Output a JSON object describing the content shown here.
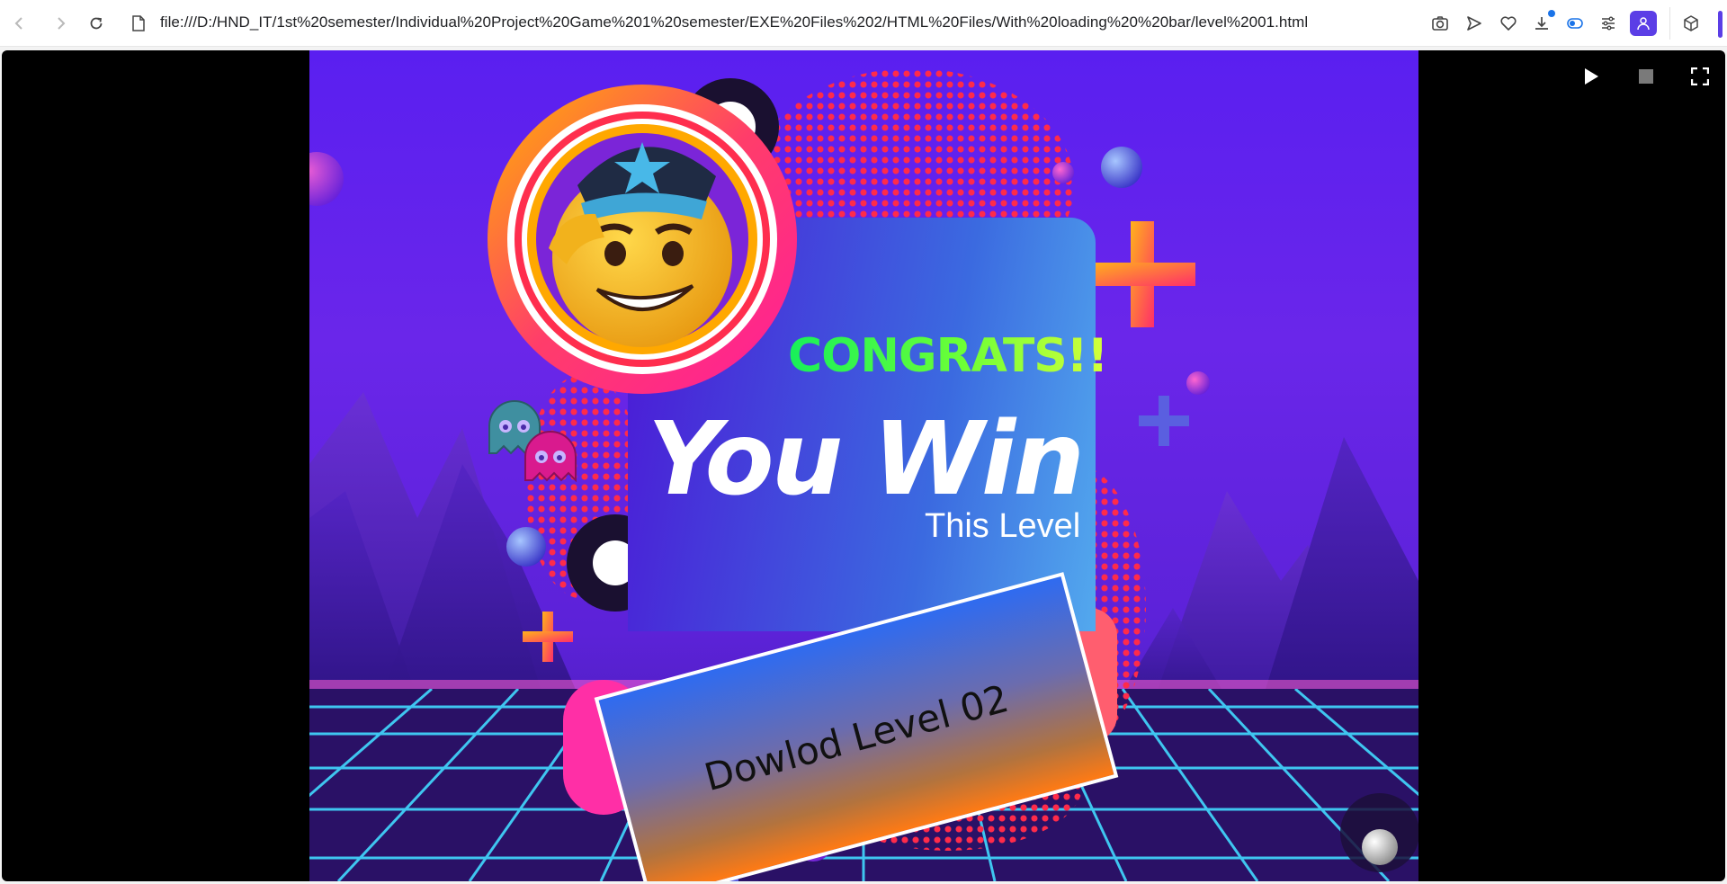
{
  "browser": {
    "url": "file:///D:/HND_IT/1st%20semester/Individual%20Project%20Game%201%20semester/EXE%20Files%202/HTML%20Files/With%20loading%20%20bar/level%2001.html",
    "icons": [
      "back-arrow-icon",
      "forward-arrow-icon",
      "reload-icon",
      "file-icon",
      "camera-icon",
      "send-icon",
      "heart-icon",
      "download-icon",
      "sidebar-toggle-icon",
      "sliders-icon",
      "profile-icon",
      "cube-icon"
    ],
    "accent_color": "#5b3ee6"
  },
  "game": {
    "heading": "CONGRATS!!",
    "title": "You Win",
    "subtitle": "This Level",
    "download_button": "Dowlod Level 02",
    "controls": [
      "play-icon",
      "stop-icon",
      "fullscreen-icon"
    ],
    "colors": {
      "background": "#5a1ff0",
      "heading_gradient": [
        "#17f05a",
        "#d6ff3a"
      ],
      "button_gradient": [
        "#2f6bf0",
        "#ff7a14"
      ],
      "dots": "#ff2b4a",
      "grid_lines": "#3fc6f0"
    }
  }
}
